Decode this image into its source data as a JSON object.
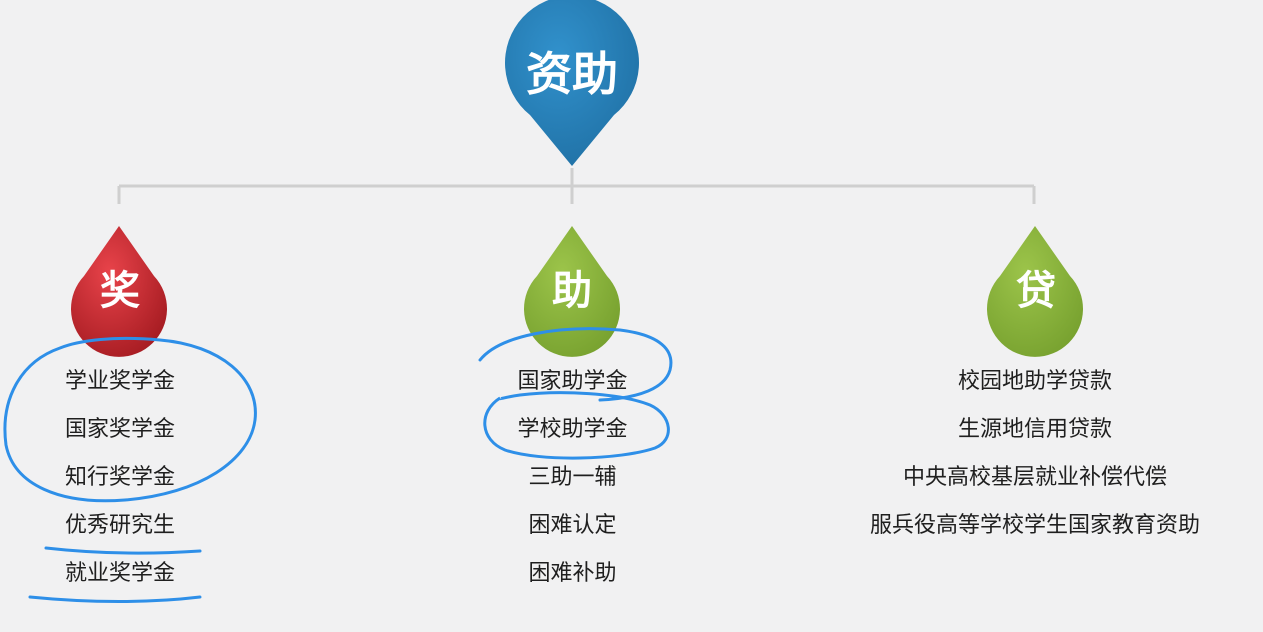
{
  "root": {
    "label": "资助",
    "color": "#2a7fb5"
  },
  "categories": [
    {
      "key": "jiang",
      "label": "奖",
      "color": "#c9262c",
      "items": [
        "学业奖学金",
        "国家奖学金",
        "知行奖学金",
        "优秀研究生",
        "就业奖学金"
      ]
    },
    {
      "key": "zhu",
      "label": "助",
      "color": "#8ab43c",
      "items": [
        "国家助学金",
        "学校助学金",
        "三助一辅",
        "困难认定",
        "困难补助"
      ]
    },
    {
      "key": "dai",
      "label": "贷",
      "color": "#8ab43c",
      "items": [
        "校园地助学贷款",
        "生源地信用贷款",
        "中央高校基层就业补偿代偿",
        "服兵役高等学校学生国家教育资助"
      ]
    }
  ],
  "annotations": {
    "color": "#2e8fe8"
  }
}
